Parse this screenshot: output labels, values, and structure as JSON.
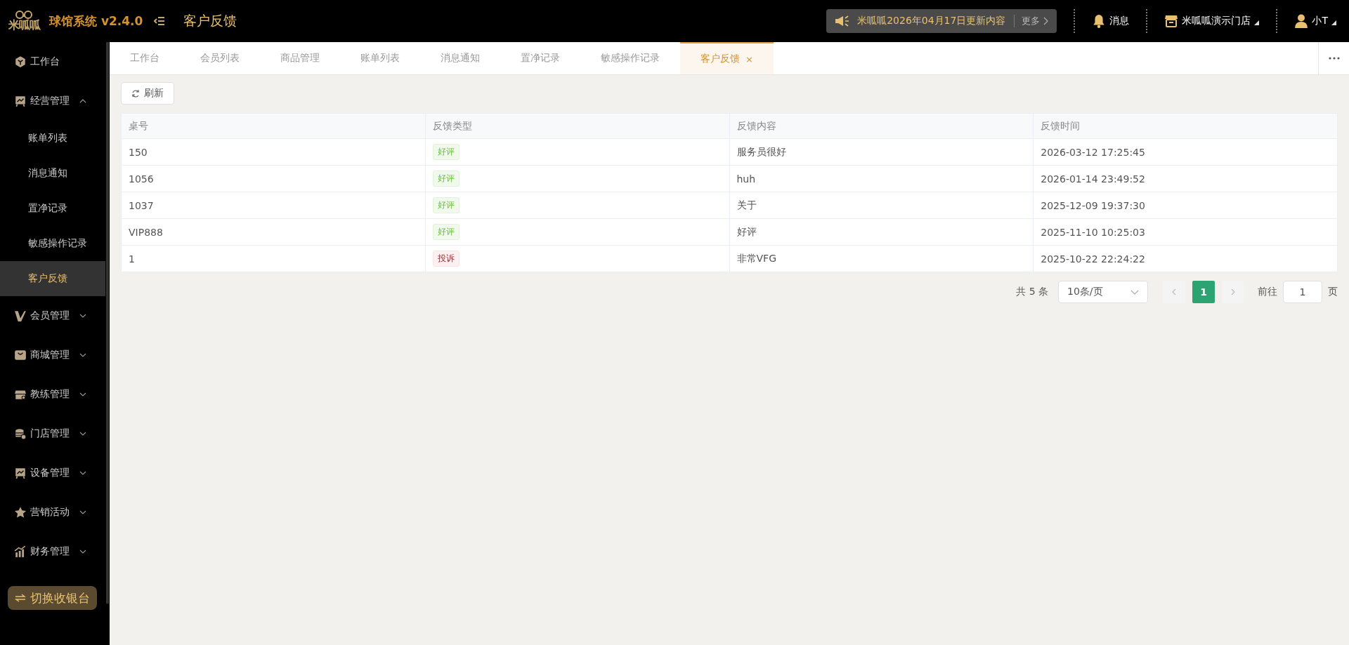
{
  "app": {
    "logo_text": "米呱呱",
    "name": "球馆系统 v2.4.0",
    "page_title": "客户反馈"
  },
  "notice": {
    "text": "米呱呱2026年04月17日更新内容",
    "more": "更多"
  },
  "header_actions": [
    {
      "kind": "bell",
      "label": "消息",
      "dropdown": false
    },
    {
      "kind": "store",
      "label": "米呱呱演示门店",
      "dropdown": true
    },
    {
      "kind": "user",
      "label": "小T",
      "dropdown": true
    }
  ],
  "sidebar": {
    "items": [
      {
        "label": "工作台",
        "selected": false
      },
      {
        "label": "经营管理",
        "expanded": true,
        "children": [
          {
            "label": "账单列表",
            "selected": false
          },
          {
            "label": "消息通知",
            "selected": false
          },
          {
            "label": "置净记录",
            "selected": false
          },
          {
            "label": "敏感操作记录",
            "selected": false
          },
          {
            "label": "客户反馈",
            "selected": true
          }
        ]
      },
      {
        "label": "会员管理",
        "expanded": false
      },
      {
        "label": "商城管理",
        "expanded": false
      },
      {
        "label": "教练管理",
        "expanded": false
      },
      {
        "label": "门店管理",
        "expanded": false
      },
      {
        "label": "设备管理",
        "expanded": false
      },
      {
        "label": "营销活动",
        "expanded": false
      },
      {
        "label": "财务管理",
        "expanded": false
      }
    ],
    "switch_button": "切换收银台"
  },
  "tabs": [
    {
      "label": "工作台",
      "selected": false
    },
    {
      "label": "会员列表",
      "selected": false
    },
    {
      "label": "商品管理",
      "selected": false
    },
    {
      "label": "账单列表",
      "selected": false
    },
    {
      "label": "消息通知",
      "selected": false
    },
    {
      "label": "置净记录",
      "selected": false
    },
    {
      "label": "敏感操作记录",
      "selected": false
    },
    {
      "label": "客户反馈",
      "selected": true,
      "close": "×"
    }
  ],
  "toolbar": {
    "refresh": "刷新"
  },
  "table": {
    "columns": [
      "桌号",
      "反馈类型",
      "反馈内容",
      "反馈时间"
    ],
    "rows": [
      {
        "table_no": "150",
        "type": {
          "kind": "good",
          "label": "好评"
        },
        "content": "服务员很好",
        "time": "2026-03-12 17:25:45"
      },
      {
        "table_no": "1056",
        "type": {
          "kind": "good",
          "label": "好评"
        },
        "content": "huh",
        "time": "2026-01-14 23:49:52"
      },
      {
        "table_no": "1037",
        "type": {
          "kind": "good",
          "label": "好评"
        },
        "content": "关于",
        "time": "2025-12-09 19:37:30"
      },
      {
        "table_no": "VIP888",
        "type": {
          "kind": "good",
          "label": "好评"
        },
        "content": "好评",
        "time": "2025-11-10 10:25:03"
      },
      {
        "table_no": "1",
        "type": {
          "kind": "complaint",
          "label": "投诉"
        },
        "content": "非常VFG",
        "time": "2025-10-22 22:24:22"
      }
    ]
  },
  "pagination": {
    "total": "共 5 条",
    "page_size": "10条/页",
    "pages": [
      {
        "label": "1",
        "selected": true
      }
    ],
    "goto_label": "前往",
    "goto_value": "1",
    "page_unit": "页"
  }
}
